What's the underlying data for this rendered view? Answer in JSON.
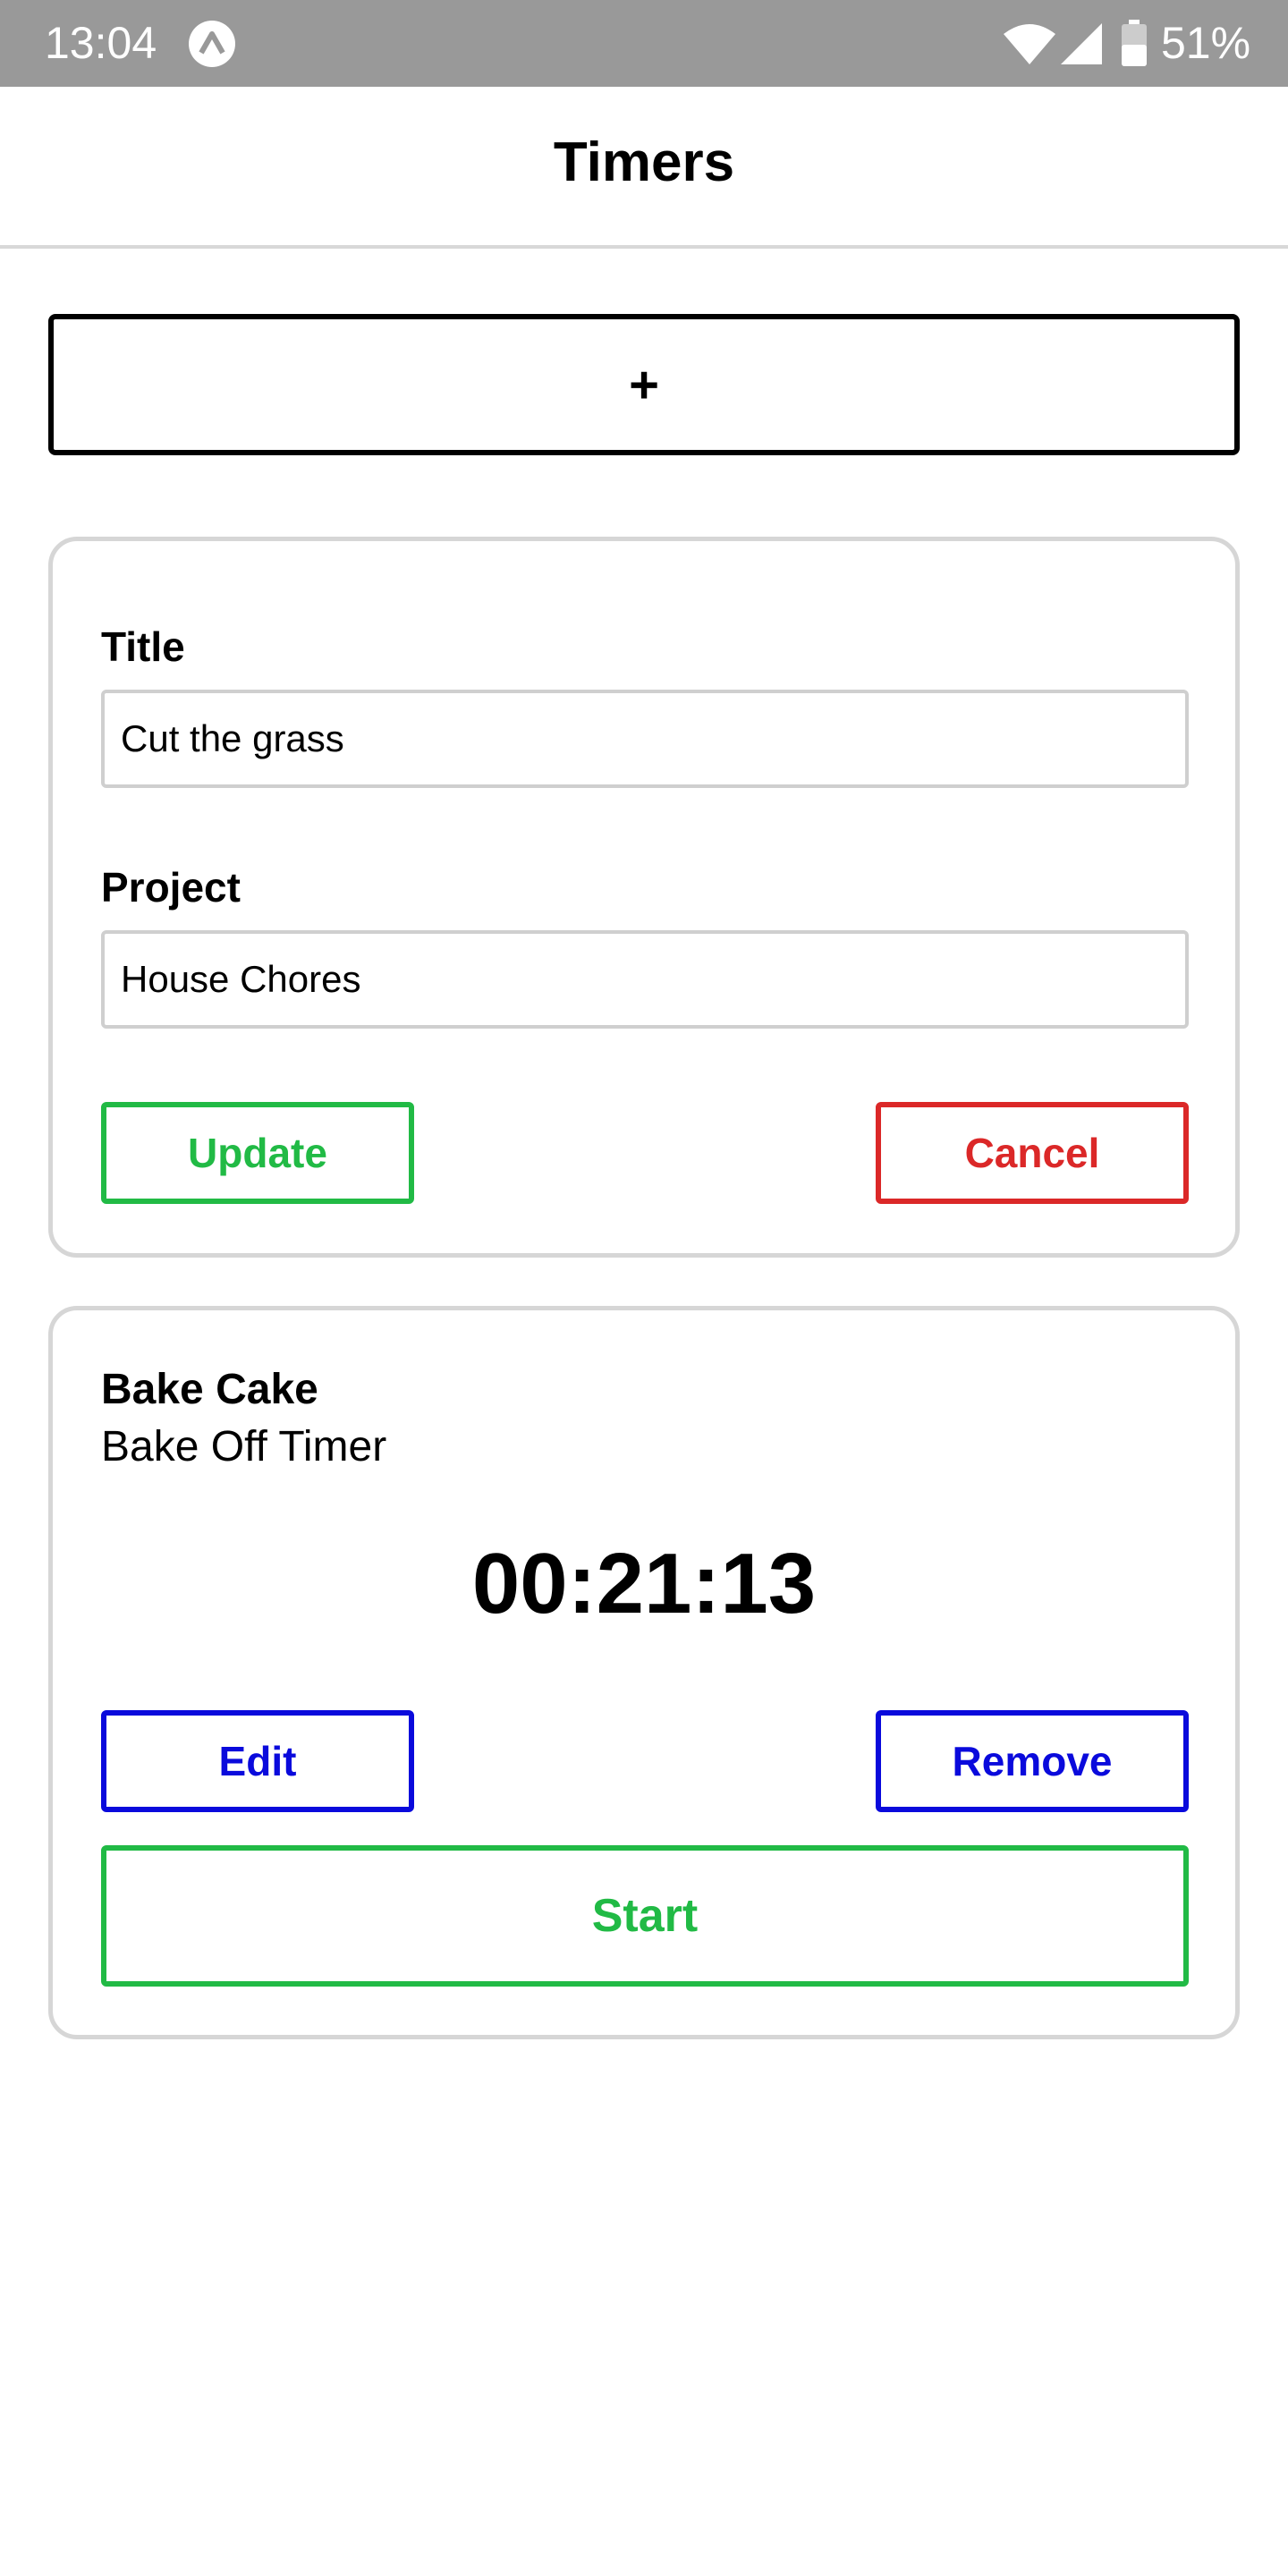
{
  "status_bar": {
    "time": "13:04",
    "battery_percent": "51%",
    "icons": [
      "app-notification-icon",
      "wifi-icon",
      "cell-signal-icon",
      "battery-icon"
    ],
    "background_color": "#999999"
  },
  "header": {
    "title": "Timers"
  },
  "add_button": {
    "label": "+"
  },
  "edit_form": {
    "title_label": "Title",
    "title_value": "Cut the grass",
    "project_label": "Project",
    "project_value": "House Chores",
    "update_label": "Update",
    "cancel_label": "Cancel"
  },
  "timer": {
    "title": "Bake Cake",
    "project": "Bake Off Timer",
    "elapsed": "00:21:13",
    "edit_label": "Edit",
    "remove_label": "Remove",
    "start_label": "Start"
  },
  "colors": {
    "green": "#21ba45",
    "red": "#db2828",
    "blue": "#0a0adc",
    "card_border": "#d6d6d6"
  }
}
